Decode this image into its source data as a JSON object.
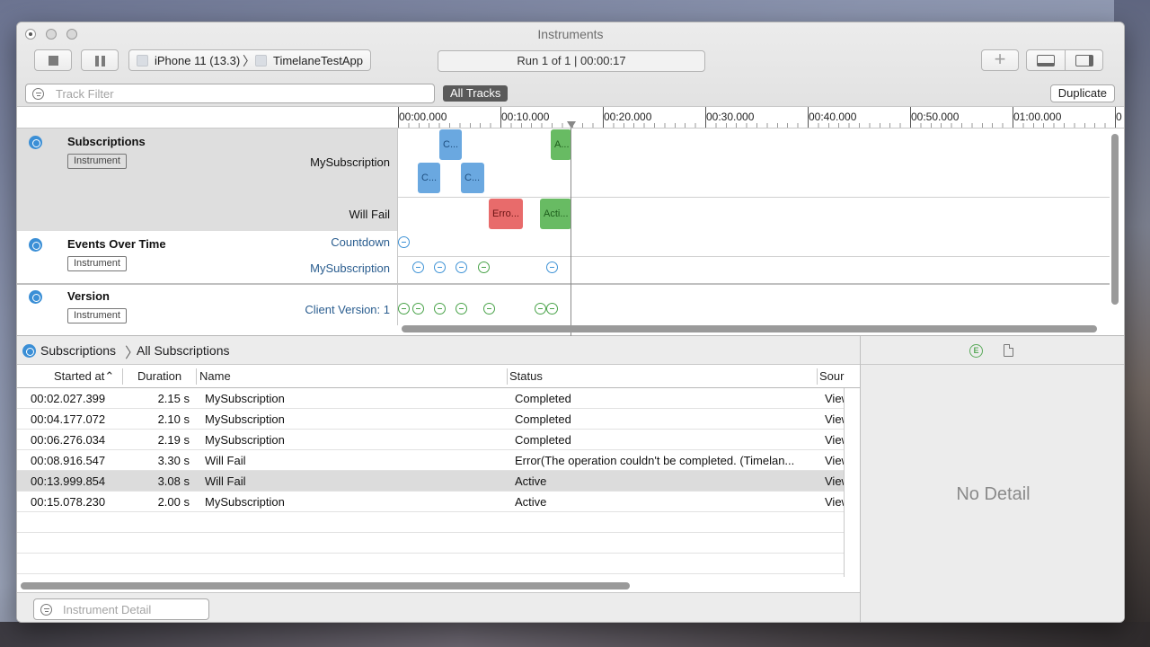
{
  "window": {
    "title": "Instruments"
  },
  "toolbar": {
    "device": "iPhone 11 (13.3)",
    "target": "TimelaneTestApp",
    "run_status": "Run 1 of 1  |  00:00:17"
  },
  "filter": {
    "track_filter_placeholder": "Track Filter",
    "all_tracks_label": "All Tracks",
    "duplicate_label": "Duplicate"
  },
  "ruler": {
    "ticks": [
      "00:00.000",
      "00:10.000",
      "00:20.000",
      "00:30.000",
      "00:40.000",
      "00:50.000",
      "01:00.000",
      "0"
    ]
  },
  "instruments": [
    {
      "name": "Subscriptions",
      "badge": "Instrument",
      "lanes": [
        "MySubscription",
        "Will Fail"
      ]
    },
    {
      "name": "Events Over Time",
      "badge": "Instrument",
      "lanes": [
        "Countdown",
        "MySubscription"
      ]
    },
    {
      "name": "Version",
      "badge": "Instrument",
      "lanes": [
        "Client Version: 1"
      ]
    }
  ],
  "intervals": {
    "c1": "C...",
    "c2": "C...",
    "c3": "C...",
    "a1": "A...",
    "err": "Erro...",
    "act": "Acti..."
  },
  "breadcrumb": {
    "root": "Subscriptions",
    "child": "All Subscriptions"
  },
  "table": {
    "columns": [
      "Started at",
      "Duration",
      "Name",
      "Status",
      "Sour"
    ],
    "rows": [
      {
        "start": "00:02.027.399",
        "duration": "2.15 s",
        "name": "MySubscription",
        "status": "Completed",
        "source": "View"
      },
      {
        "start": "00:04.177.072",
        "duration": "2.10 s",
        "name": "MySubscription",
        "status": "Completed",
        "source": "View"
      },
      {
        "start": "00:06.276.034",
        "duration": "2.19 s",
        "name": "MySubscription",
        "status": "Completed",
        "source": "View"
      },
      {
        "start": "00:08.916.547",
        "duration": "3.30 s",
        "name": "Will Fail",
        "status": "Error(The operation couldn't be completed. (Timelan...",
        "source": "View"
      },
      {
        "start": "00:13.999.854",
        "duration": "3.08 s",
        "name": "Will Fail",
        "status": "Active",
        "source": "View"
      },
      {
        "start": "00:15.078.230",
        "duration": "2.00 s",
        "name": "MySubscription",
        "status": "Active",
        "source": "View"
      }
    ]
  },
  "detail_filter_placeholder": "Instrument Detail",
  "inspector": {
    "empty_text": "No Detail"
  },
  "colors": {
    "blue_interval": "#6aa8e0",
    "green_interval": "#68bb63",
    "red_interval": "#e86b6b",
    "instrument_icon": "#3b8fd6"
  },
  "icons": [
    "stop-icon",
    "pause-icon",
    "device-icon",
    "app-icon",
    "add-icon",
    "bottom-panel-icon",
    "right-panel-icon",
    "filter-icon",
    "instrument-icon",
    "pin-icon",
    "signpost-icon",
    "extended-detail-icon",
    "document-icon"
  ]
}
